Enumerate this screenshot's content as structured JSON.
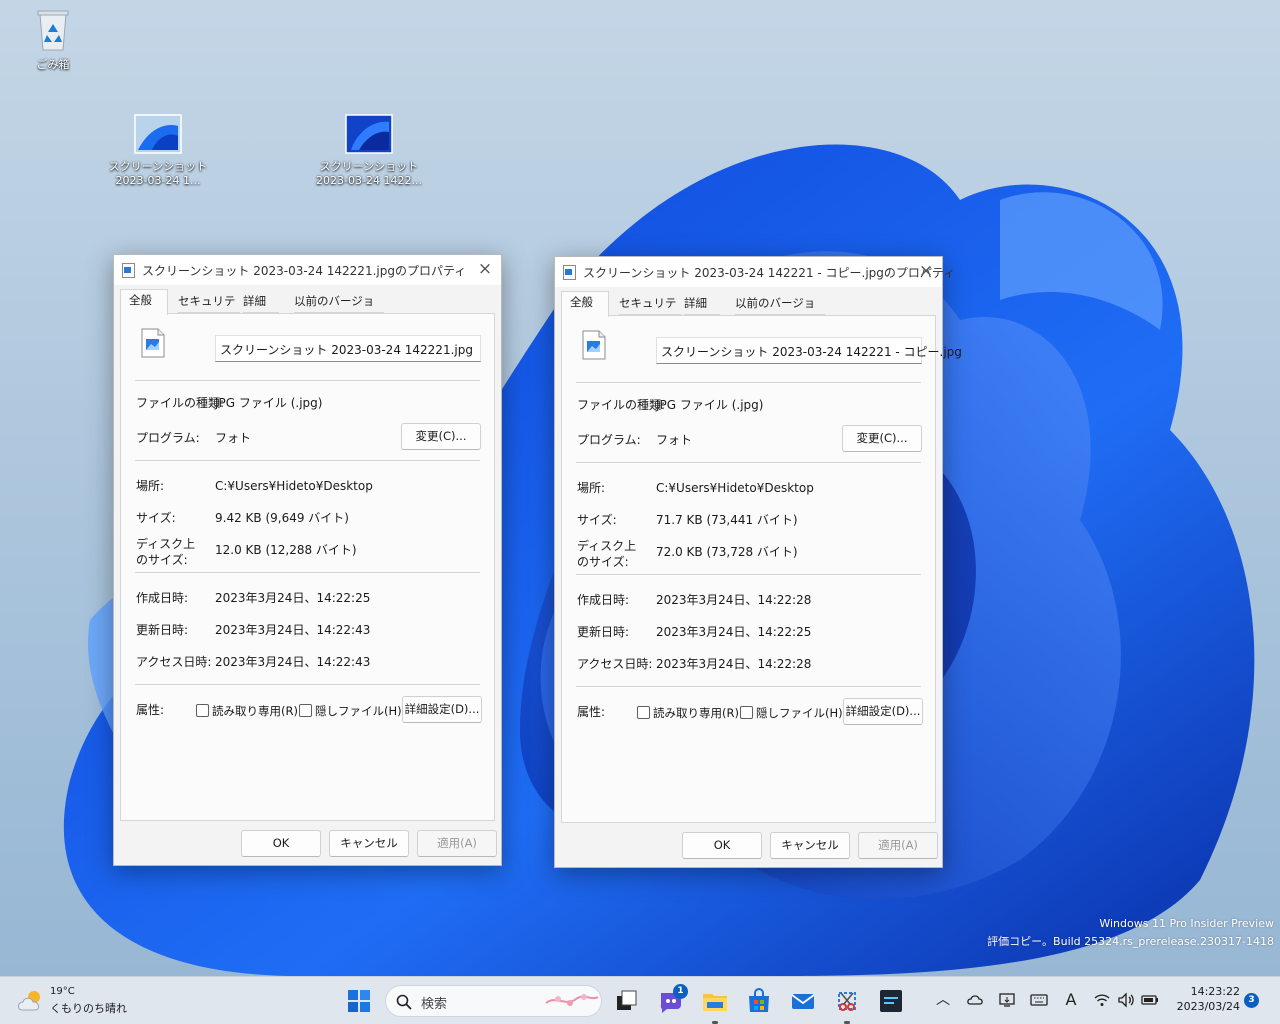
{
  "desktop": {
    "recycle_bin": "ごみ箱",
    "icon1": {
      "line1": "スクリーンショット",
      "line2": "2023-03-24 1..."
    },
    "icon2": {
      "line1": "スクリーンショット",
      "line2": "2023-03-24 1422..."
    }
  },
  "dialogs": [
    {
      "title": "スクリーンショット 2023-03-24 142221.jpgのプロパティ",
      "tabs": [
        "全般",
        "セキュリティ",
        "詳細",
        "以前のバージョン"
      ],
      "filename": "スクリーンショット 2023-03-24 142221.jpg",
      "type_label": "ファイルの種類:",
      "type_value": "JPG ファイル (.jpg)",
      "program_label": "プログラム:",
      "program_value": "フォト",
      "change_button": "変更(C)...",
      "location_label": "場所:",
      "location_value": "C:¥Users¥Hideto¥Desktop",
      "size_label": "サイズ:",
      "size_value": "9.42 KB (9,649 バイト)",
      "disk_label1": "ディスク上",
      "disk_label2": "のサイズ:",
      "disk_value": "12.0 KB (12,288 バイト)",
      "created_label": "作成日時:",
      "created_value": "2023年3月24日、14:22:25",
      "modified_label": "更新日時:",
      "modified_value": "2023年3月24日、14:22:43",
      "accessed_label": "アクセス日時:",
      "accessed_value": "2023年3月24日、14:22:43",
      "attr_label": "属性:",
      "readonly_label": "読み取り専用(R)",
      "hidden_label": "隠しファイル(H)",
      "advanced_button": "詳細設定(D)...",
      "ok": "OK",
      "cancel": "キャンセル",
      "apply": "適用(A)"
    },
    {
      "title": "スクリーンショット 2023-03-24 142221 - コピー.jpgのプロパティ",
      "tabs": [
        "全般",
        "セキュリティ",
        "詳細",
        "以前のバージョン"
      ],
      "filename": "スクリーンショット 2023-03-24 142221 - コピー.jpg",
      "type_label": "ファイルの種類:",
      "type_value": "JPG ファイル (.jpg)",
      "program_label": "プログラム:",
      "program_value": "フォト",
      "change_button": "変更(C)...",
      "location_label": "場所:",
      "location_value": "C:¥Users¥Hideto¥Desktop",
      "size_label": "サイズ:",
      "size_value": "71.7 KB (73,441 バイト)",
      "disk_label1": "ディスク上",
      "disk_label2": "のサイズ:",
      "disk_value": "72.0 KB (73,728 バイト)",
      "created_label": "作成日時:",
      "created_value": "2023年3月24日、14:22:28",
      "modified_label": "更新日時:",
      "modified_value": "2023年3月24日、14:22:25",
      "accessed_label": "アクセス日時:",
      "accessed_value": "2023年3月24日、14:22:28",
      "attr_label": "属性:",
      "readonly_label": "読み取り専用(R)",
      "hidden_label": "隠しファイル(H)",
      "advanced_button": "詳細設定(D)...",
      "ok": "OK",
      "cancel": "キャンセル",
      "apply": "適用(A)"
    }
  ],
  "watermark": {
    "line1": "Windows 11 Pro Insider Preview",
    "line2": "評価コピー。Build 25324.rs_prerelease.230317-1418"
  },
  "taskbar": {
    "weather_temp": "19°C",
    "weather_desc": "くもりのち晴れ",
    "search_placeholder": "検索",
    "chat_badge": "1",
    "time": "14:23:22",
    "date": "2023/03/24",
    "notification_count": "3",
    "ime_mode": "A",
    "accent": "#0a5fc1"
  }
}
